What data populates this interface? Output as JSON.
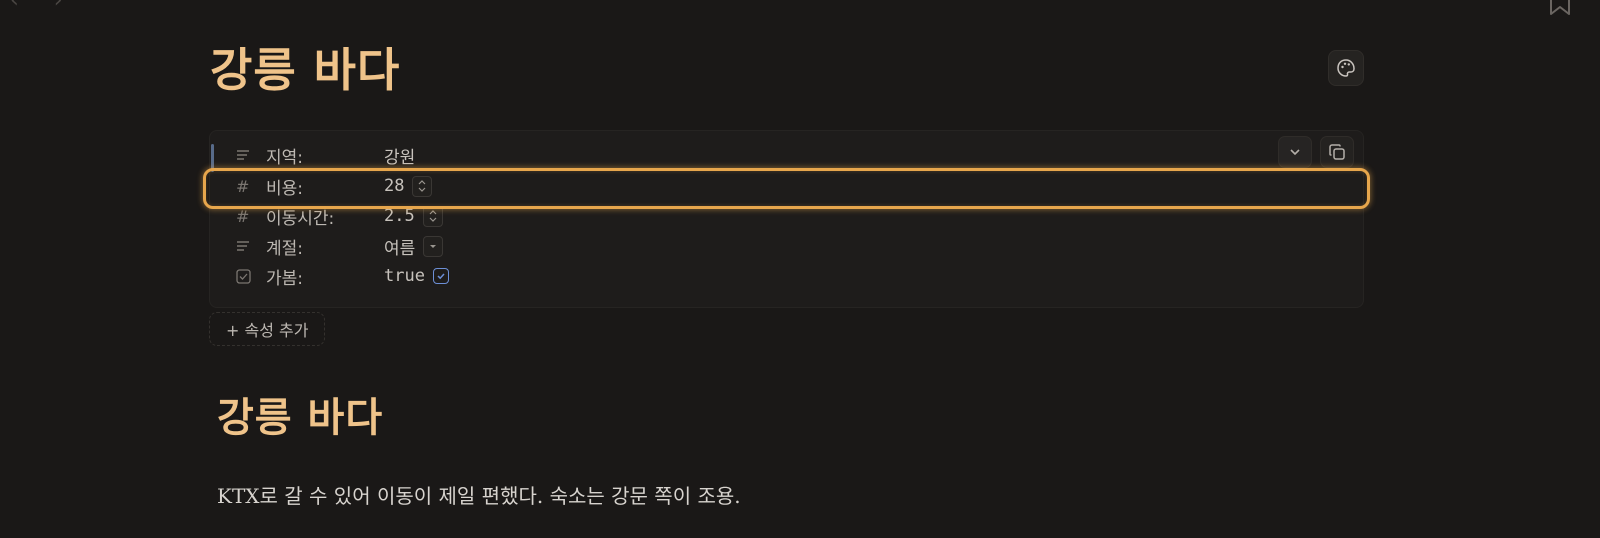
{
  "top_chrome": {
    "nav_glyphs": "‹ ›"
  },
  "page": {
    "title": "강릉 바다"
  },
  "properties": [
    {
      "icon": "text-lines-icon",
      "key": "지역:",
      "value": "강원",
      "control": "none"
    },
    {
      "icon": "hash-icon",
      "key": "비용:",
      "value": "28",
      "control": "stepper"
    },
    {
      "icon": "hash-icon",
      "key": "이동시간:",
      "value": "2.5",
      "control": "stepper"
    },
    {
      "icon": "text-lines-icon",
      "key": "계절:",
      "value": "여름",
      "control": "dropdown"
    },
    {
      "icon": "checkbox-icon",
      "key": "가봄:",
      "value": "true",
      "control": "checkbox"
    }
  ],
  "add_property_label": "+ 속성 추가",
  "content": {
    "heading": "강릉 바다",
    "paragraph": "KTX로 갈 수 있어 이동이 제일 편했다. 숙소는 강문 쪽이 조용."
  },
  "colors": {
    "background": "#1a1817",
    "title_accent": "#efc38a",
    "highlight": "#e7a64c",
    "checkbox": "#6d8fd6"
  }
}
